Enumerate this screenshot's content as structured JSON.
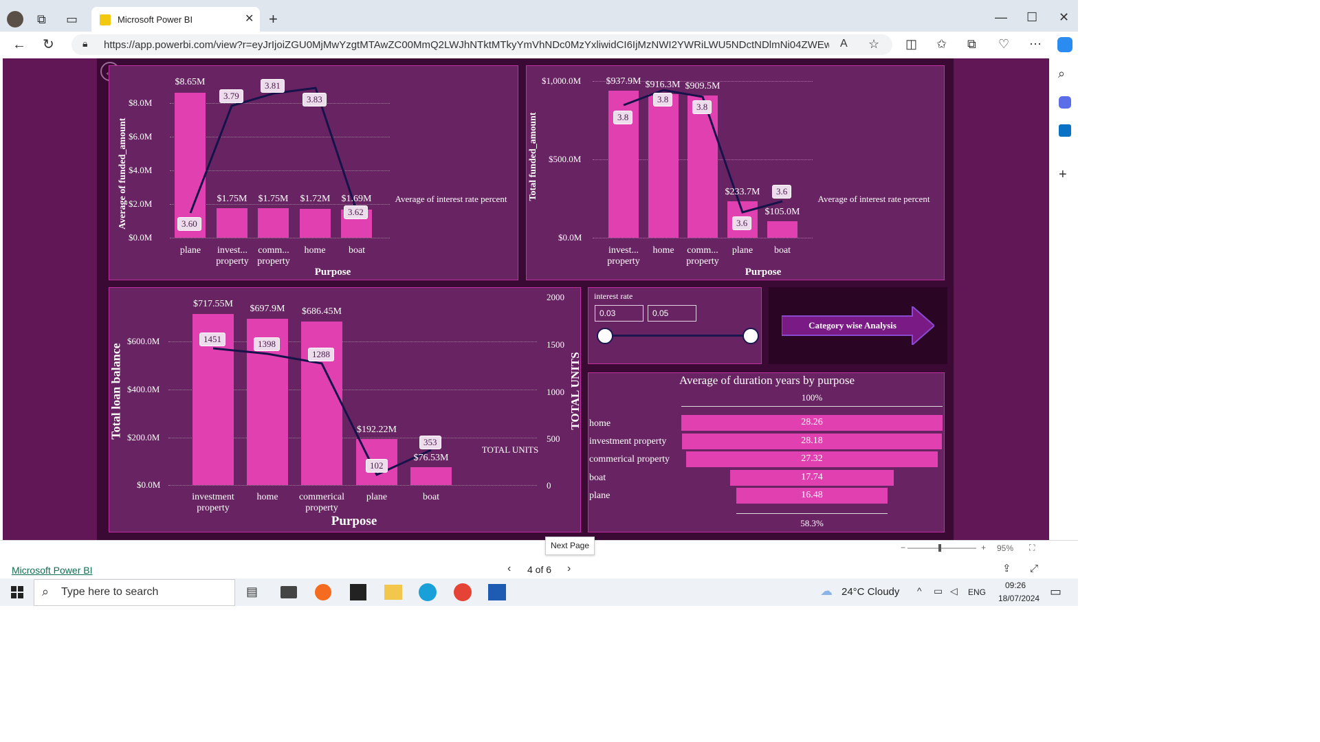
{
  "browser": {
    "tab_title": "Microsoft Power BI",
    "url": "https://app.powerbi.com/view?r=eyJrIjoiZGU0MjMwYzgtMTAwZC00MmQ2LWJhNTktMTkyYmVhNDc0MzYxliwidCI6IjMzNWI2YWRiLWU5NDctNDlmNi04ZWEwLTJmMz..."
  },
  "report": {
    "chart1": {
      "ylabel": "Average of funded_amount",
      "xlabel": "Purpose",
      "secondary_label": "Average of interest rate percent",
      "ticks": [
        "$8.0M",
        "$6.0M",
        "$4.0M",
        "$2.0M",
        "$0.0M"
      ],
      "categories": [
        "plane",
        "invest...\nproperty",
        "comm...\nproperty",
        "home",
        "boat"
      ],
      "bar_labels": [
        "$8.65M",
        "$1.75M",
        "$1.75M",
        "$1.72M",
        "$1.69M"
      ],
      "line_labels": [
        "3.60",
        "3.79",
        "3.81",
        "3.83",
        "3.62"
      ]
    },
    "chart2": {
      "ylabel": "Total funded_amount",
      "xlabel": "Purpose",
      "secondary_label": "Average of interest rate percent",
      "ticks": [
        "$1,000.0M",
        "$500.0M",
        "$0.0M"
      ],
      "categories": [
        "invest...\nproperty",
        "home",
        "comm...\nproperty",
        "plane",
        "boat"
      ],
      "bar_labels": [
        "$937.9M",
        "$916.3M",
        "$909.5M",
        "$233.7M",
        "$105.0M"
      ],
      "line_labels": [
        "3.8",
        "3.8",
        "3.8",
        "3.6",
        "3.6"
      ]
    },
    "chart3": {
      "ylabel": "Total loan balance",
      "xlabel": "Purpose",
      "secondary_axis_title": "TOTAL UNITS",
      "secondary_label": "TOTAL UNITS",
      "ticks": [
        "$600.0M",
        "$400.0M",
        "$200.0M",
        "$0.0M"
      ],
      "right_ticks": [
        "2000",
        "1500",
        "1000",
        "500",
        "0"
      ],
      "categories": [
        "investment\nproperty",
        "home",
        "commerical\nproperty",
        "plane",
        "boat"
      ],
      "bar_labels": [
        "$717.55M",
        "$697.9M",
        "$686.45M",
        "$192.22M",
        "$76.53M"
      ],
      "line_labels": [
        "1451",
        "1398",
        "1288",
        "102",
        "353"
      ]
    },
    "slicer": {
      "title": "interest rate",
      "min_value": "0.03",
      "max_value": "0.05"
    },
    "nav_button": "Category wise Analysis",
    "funnel": {
      "title": "Average of duration years by purpose",
      "top_pct": "100%",
      "bottom_pct": "58.3%",
      "rows": [
        {
          "label": "home",
          "value": "28.26"
        },
        {
          "label": "investment property",
          "value": "28.18"
        },
        {
          "label": "commerical property",
          "value": "27.32"
        },
        {
          "label": "boat",
          "value": "17.74"
        },
        {
          "label": "plane",
          "value": "16.48"
        }
      ]
    }
  },
  "chart_data": [
    {
      "type": "bar",
      "title": "",
      "xlabel": "Purpose",
      "ylabel": "Average of funded_amount",
      "categories": [
        "plane",
        "investment property",
        "commerical property",
        "home",
        "boat"
      ],
      "series": [
        {
          "name": "Average of funded_amount",
          "values": [
            8.65,
            1.75,
            1.75,
            1.72,
            1.69
          ]
        },
        {
          "name": "Average of interest rate percent",
          "values": [
            3.6,
            3.79,
            3.81,
            3.83,
            3.62
          ]
        }
      ],
      "ylim": [
        0,
        9
      ]
    },
    {
      "type": "bar",
      "title": "",
      "xlabel": "Purpose",
      "ylabel": "Total funded_amount",
      "categories": [
        "investment property",
        "home",
        "commerical property",
        "plane",
        "boat"
      ],
      "series": [
        {
          "name": "Total funded_amount",
          "values": [
            937.9,
            916.3,
            909.5,
            233.7,
            105.0
          ]
        },
        {
          "name": "Average of interest rate percent",
          "values": [
            3.8,
            3.8,
            3.8,
            3.6,
            3.6
          ]
        }
      ],
      "ylim": [
        0,
        1000
      ]
    },
    {
      "type": "bar",
      "title": "",
      "xlabel": "Purpose",
      "ylabel": "Total loan balance",
      "categories": [
        "investment property",
        "home",
        "commerical property",
        "plane",
        "boat"
      ],
      "series": [
        {
          "name": "Total loan balance",
          "values": [
            717.55,
            697.9,
            686.45,
            192.22,
            76.53
          ]
        },
        {
          "name": "TOTAL UNITS",
          "values": [
            1451,
            1398,
            1288,
            102,
            353
          ]
        }
      ],
      "ylim": [
        0,
        700
      ]
    },
    {
      "type": "bar",
      "title": "Average of duration years by purpose",
      "categories": [
        "home",
        "investment property",
        "commerical property",
        "boat",
        "plane"
      ],
      "values": [
        28.26,
        28.18,
        27.32,
        17.74,
        16.48
      ]
    }
  ],
  "pager": {
    "current": "4 of 6",
    "tooltip": "Next Page",
    "footer_link": "Microsoft Power BI",
    "zoom": "95%"
  },
  "taskbar": {
    "search_placeholder": "Type here to search",
    "weather": "24°C  Cloudy",
    "lang": "ENG",
    "time": "09:26",
    "date": "18/07/2024"
  }
}
